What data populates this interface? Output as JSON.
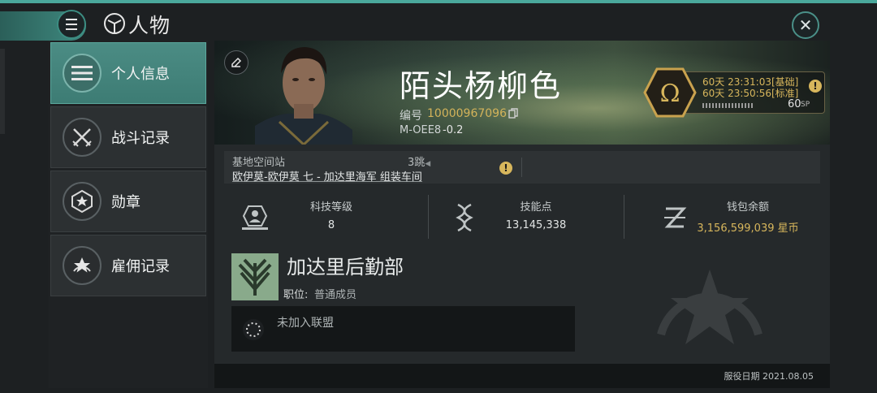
{
  "header": {
    "title": "人物",
    "menu_icon": "menu-icon",
    "title_icon": "character-icon",
    "close_icon": "close-icon"
  },
  "sidebar": {
    "items": [
      {
        "label": "个人信息",
        "icon": "list-icon",
        "active": true
      },
      {
        "label": "战斗记录",
        "icon": "crossed-swords-icon",
        "active": false
      },
      {
        "label": "勋章",
        "icon": "star-medal-icon",
        "active": false
      },
      {
        "label": "雇佣记录",
        "icon": "star-laurel-icon",
        "active": false
      }
    ]
  },
  "profile": {
    "name": "陌头杨柳色",
    "id_label": "编号",
    "id_value": "10000967096",
    "location_code": "M-OEE8",
    "security": "-0.2"
  },
  "omega": {
    "line1": "60天 23:31:03[基础]",
    "line2": "60天 23:50:56[标准]",
    "sp_value": "60",
    "sp_unit": "SP"
  },
  "station": {
    "label": "基地空间站",
    "jumps": "3跳",
    "name": "欧伊莫-欧伊莫 七 - 加达里海军 组装车间"
  },
  "stats": [
    {
      "label": "科技等级",
      "value": "8",
      "icon": "tech-level-icon"
    },
    {
      "label": "技能点",
      "value": "13,145,338",
      "icon": "dna-icon"
    },
    {
      "label": "钱包余额",
      "value": "3,156,599,039 星币",
      "icon": "isk-icon"
    }
  ],
  "corporation": {
    "name": "加达里后勤部",
    "position_label": "职位:",
    "position_value": "普通成员"
  },
  "alliance": {
    "text": "未加入联盟"
  },
  "footer": {
    "service_date": "服役日期 2021.08.05"
  },
  "colors": {
    "accent": "#4aa89c",
    "gold": "#d7b65c",
    "sidebar_active": "#4b8c84"
  }
}
